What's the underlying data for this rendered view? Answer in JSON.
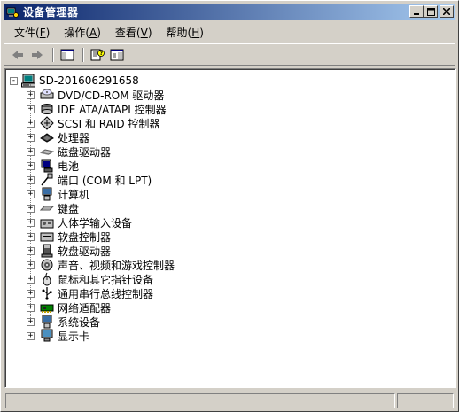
{
  "window": {
    "title": "设备管理器"
  },
  "menubar": {
    "items": [
      {
        "label": "文件",
        "accel": "F"
      },
      {
        "label": "操作",
        "accel": "A"
      },
      {
        "label": "查看",
        "accel": "V"
      },
      {
        "label": "帮助",
        "accel": "H"
      }
    ]
  },
  "toolbar": {
    "buttons": [
      "back-arrow-icon",
      "forward-arrow-icon",
      "show-hide-tree-icon",
      "properties-help-icon",
      "details-pane-icon"
    ]
  },
  "tree": {
    "root": {
      "label": "SD-201606291658",
      "expander": "-",
      "icon": "computer-icon"
    },
    "nodes": [
      {
        "label": "DVD/CD-ROM 驱动器",
        "icon": "cdrom-icon",
        "expander": "+"
      },
      {
        "label": "IDE ATA/ATAPI 控制器",
        "icon": "ide-controller-icon",
        "expander": "+"
      },
      {
        "label": "SCSI 和 RAID 控制器",
        "icon": "scsi-controller-icon",
        "expander": "+"
      },
      {
        "label": "处理器",
        "icon": "processor-icon",
        "expander": "+"
      },
      {
        "label": "磁盘驱动器",
        "icon": "disk-drive-icon",
        "expander": "+"
      },
      {
        "label": "电池",
        "icon": "battery-icon",
        "expander": "+"
      },
      {
        "label": "端口 (COM 和 LPT)",
        "icon": "port-icon",
        "expander": "+"
      },
      {
        "label": "计算机",
        "icon": "computer-icon",
        "expander": "+"
      },
      {
        "label": "键盘",
        "icon": "keyboard-icon",
        "expander": "+"
      },
      {
        "label": "人体学输入设备",
        "icon": "hid-icon",
        "expander": "+"
      },
      {
        "label": "软盘控制器",
        "icon": "floppy-controller-icon",
        "expander": "+"
      },
      {
        "label": "软盘驱动器",
        "icon": "floppy-drive-icon",
        "expander": "+"
      },
      {
        "label": "声音、视频和游戏控制器",
        "icon": "sound-icon",
        "expander": "+"
      },
      {
        "label": "鼠标和其它指针设备",
        "icon": "mouse-icon",
        "expander": "+"
      },
      {
        "label": "通用串行总线控制器",
        "icon": "usb-icon",
        "expander": "+"
      },
      {
        "label": "网络适配器",
        "icon": "network-adapter-icon",
        "expander": "+"
      },
      {
        "label": "系统设备",
        "icon": "system-devices-icon",
        "expander": "+"
      },
      {
        "label": "显示卡",
        "icon": "display-adapter-icon",
        "expander": "+"
      }
    ]
  },
  "statusbar": {
    "panels": [
      "",
      ""
    ]
  },
  "colors": {
    "titlebar_start": "#0a246a",
    "titlebar_end": "#a6caf0",
    "face": "#d4d0c8"
  }
}
